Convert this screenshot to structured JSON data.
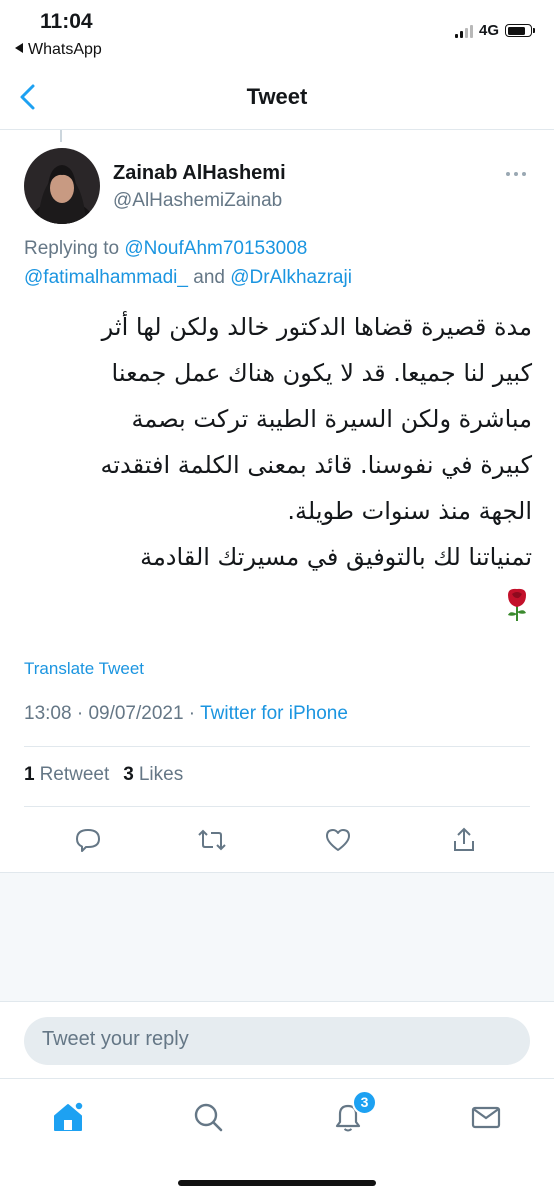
{
  "status_bar": {
    "time": "11:04",
    "back_app": "WhatsApp",
    "network": "4G"
  },
  "nav": {
    "title": "Tweet"
  },
  "tweet": {
    "display_name": "Zainab AlHashemi",
    "handle": "@AlHashemiZainab",
    "replying_prefix": "Replying to ",
    "replying_to": [
      "@NoufAhm70153008",
      "@fatimalhammadi_",
      "@DrAlkhazraji"
    ],
    "replying_joiner": " and ",
    "body": "مدة قصيرة قضاها الدكتور خالد ولكن لها أثر\nكبير لنا جميعا. قد لا يكون هناك عمل جمعنا\nمباشرة ولكن السيرة الطيبة تركت بصمة\nكبيرة في نفوسنا. قائد بمعنى الكلمة افتقدته\nالجهة منذ سنوات طويلة.\nتمنياتنا لك بالتوفيق في مسيرتك القادمة",
    "emoji": "rose",
    "translate_label": "Translate Tweet",
    "time": "13:08",
    "date": "09/07/2021",
    "separator": " · ",
    "client": "Twitter for iPhone"
  },
  "stats": {
    "retweets_count": "1",
    "retweets_label": "Retweet",
    "likes_count": "3",
    "likes_label": "Likes"
  },
  "reply_box": {
    "placeholder": "Tweet your reply"
  },
  "tab_bar": {
    "notifications_badge": "3"
  },
  "colors": {
    "twitter_blue": "#1da1f2",
    "link_blue": "#1b95e0",
    "secondary_text": "#657786",
    "divider": "#e1e8ed"
  }
}
